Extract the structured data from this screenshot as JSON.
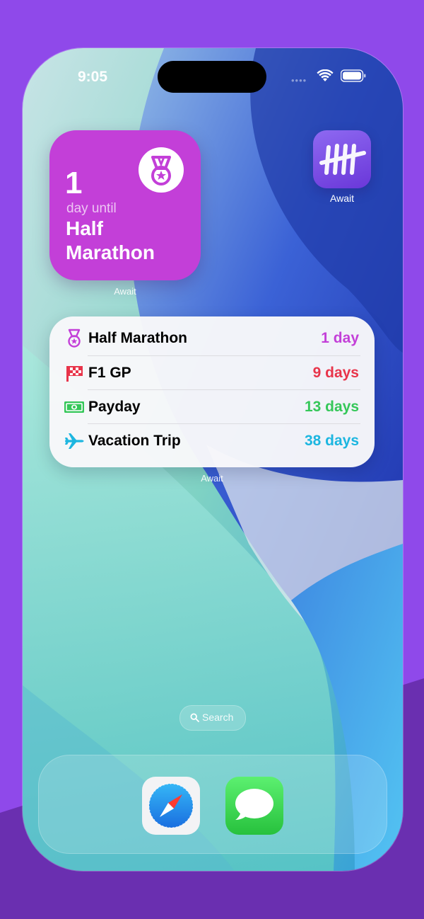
{
  "status_bar": {
    "time": "9:05"
  },
  "big_widget": {
    "count": "1",
    "subtitle": "day until",
    "title": "Half Marathon",
    "icon": "medal-icon",
    "label": "Await",
    "color": "#c33fd8"
  },
  "app_icon": {
    "label": "Await",
    "icon": "tally-marks-icon"
  },
  "list_widget": {
    "label": "Await",
    "rows": [
      {
        "name": "Half Marathon",
        "days": "1 day",
        "icon": "medal-icon",
        "color": "#c33fd8"
      },
      {
        "name": "F1 GP",
        "days": "9 days",
        "icon": "checkered-flag-icon",
        "color": "#e8344a"
      },
      {
        "name": "Payday",
        "days": "13 days",
        "icon": "banknote-icon",
        "color": "#35c759"
      },
      {
        "name": "Vacation Trip",
        "days": "38 days",
        "icon": "airplane-icon",
        "color": "#1cb6e0"
      }
    ]
  },
  "search": {
    "label": "Search"
  },
  "dock": {
    "apps": [
      {
        "icon": "safari-icon"
      },
      {
        "icon": "messages-icon"
      }
    ]
  }
}
